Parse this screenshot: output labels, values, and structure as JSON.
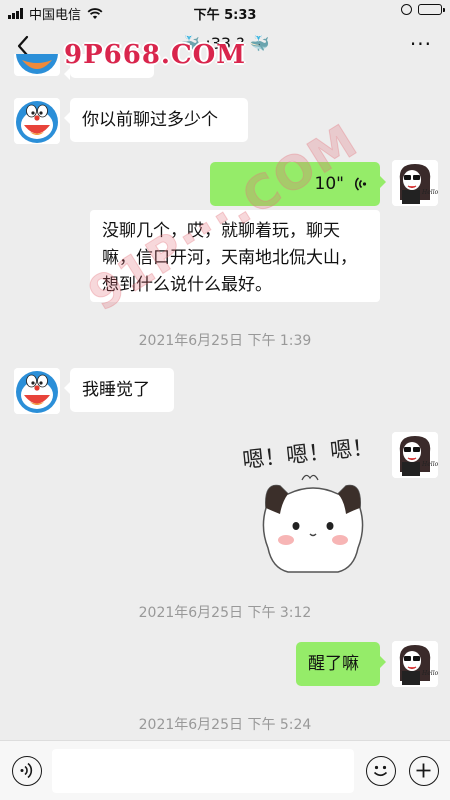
{
  "status_bar": {
    "carrier": "中国电信",
    "time": "下午 5:33",
    "battery_level": 0.92
  },
  "nav": {
    "title": "🐳 :33 ? 🐳",
    "more_label": "···"
  },
  "watermarks": {
    "top": "9P668.COM",
    "diagonal": "91P···.COM"
  },
  "messages": {
    "m1": {
      "text": "你以前聊过多少个"
    },
    "m2": {
      "duration": "10\""
    },
    "m2_transcript": {
      "text": "没聊几个，哎，就聊着玩，聊天嘛，信口开河，天南地北侃大山，想到什么说什么最好。"
    },
    "ts1": "2021年6月25日 下午 1:39",
    "m3": {
      "text": "我睡觉了"
    },
    "m4": {
      "sticker_text": "嗯！嗯！嗯！"
    },
    "ts2": "2021年6月25日 下午 3:12",
    "m5": {
      "text": "醒了嘛"
    },
    "ts3": "2021年6月25日 下午 5:24"
  },
  "composer": {
    "input_value": ""
  },
  "colors": {
    "background": "#ededed",
    "sent_bubble": "#95ec69",
    "received_bubble": "#ffffff",
    "timestamp": "#999999",
    "watermark": "#d9264d"
  },
  "icons": {
    "back": "chevron-left-icon",
    "more": "more-icon",
    "voice": "voice-icon",
    "emoji": "emoji-icon",
    "plus": "plus-icon",
    "voice_wave": "voice-wave-icon"
  }
}
